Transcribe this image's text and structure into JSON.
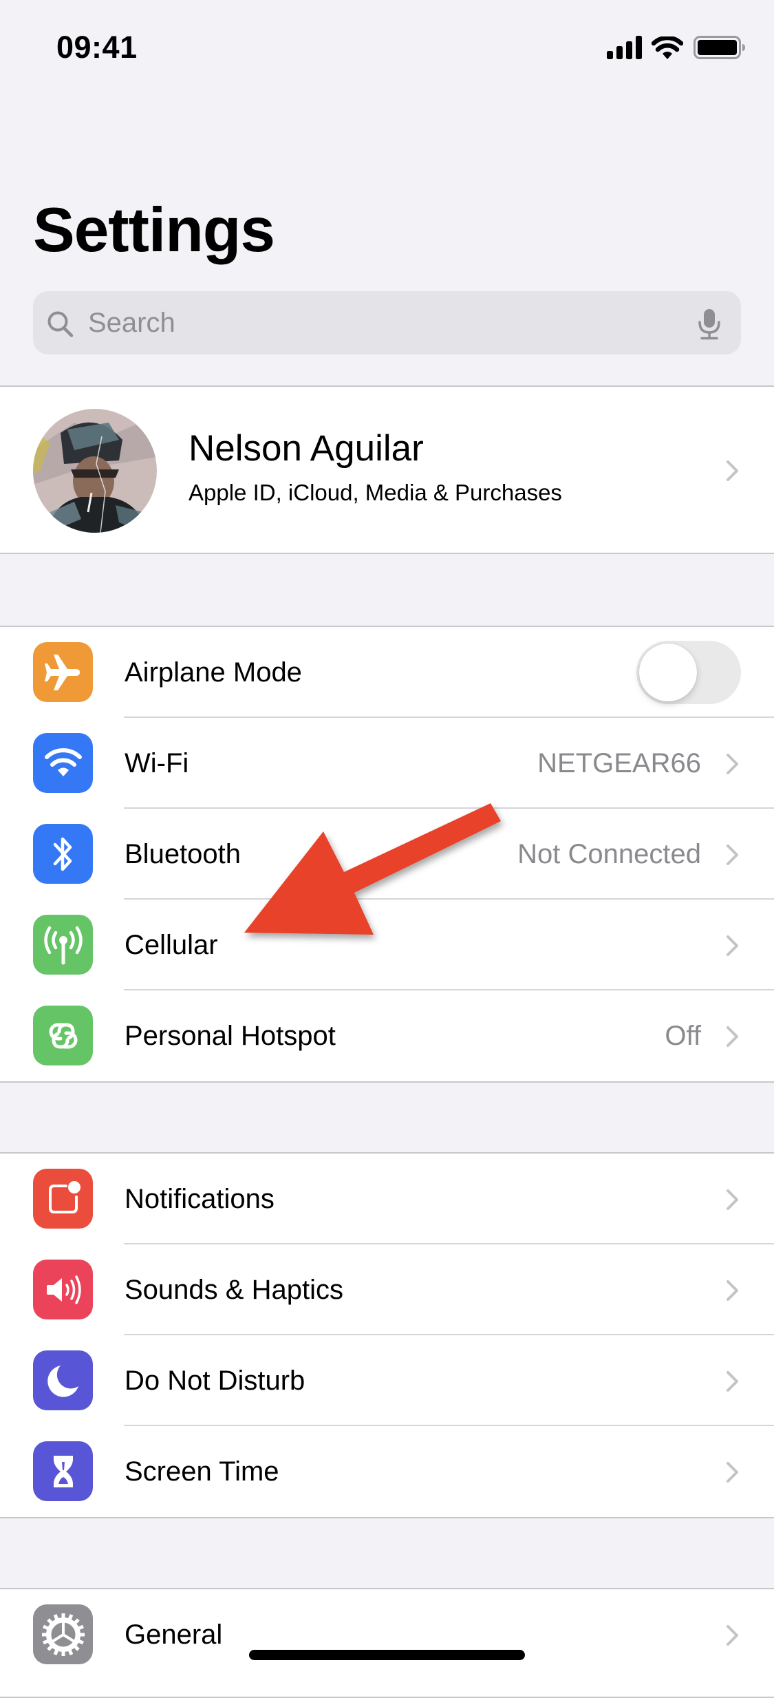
{
  "status_bar": {
    "time": "09:41",
    "icons": [
      "cellular-signal-icon",
      "wifi-icon",
      "battery-icon"
    ]
  },
  "header": {
    "title": "Settings"
  },
  "search": {
    "placeholder": "Search",
    "value": "",
    "icons": [
      "search-icon",
      "microphone-icon"
    ]
  },
  "profile": {
    "name": "Nelson Aguilar",
    "subtitle": "Apple ID, iCloud, Media & Purchases"
  },
  "groups": [
    {
      "rows": [
        {
          "label": "Airplane Mode",
          "icon": "airplane-icon",
          "icon_color": "#f09a37",
          "type": "toggle",
          "toggle_on": false
        },
        {
          "label": "Wi-Fi",
          "icon": "wifi-icon",
          "icon_color": "#3478f6",
          "value": "NETGEAR66",
          "type": "link"
        },
        {
          "label": "Bluetooth",
          "icon": "bluetooth-icon",
          "icon_color": "#3478f6",
          "value": "Not Connected",
          "type": "link"
        },
        {
          "label": "Cellular",
          "icon": "cellular-antenna-icon",
          "icon_color": "#65c466",
          "value": "",
          "type": "link"
        },
        {
          "label": "Personal Hotspot",
          "icon": "hotspot-icon",
          "icon_color": "#65c466",
          "value": "Off",
          "type": "link"
        }
      ]
    },
    {
      "rows": [
        {
          "label": "Notifications",
          "icon": "notifications-icon",
          "icon_color": "#eb4d3d",
          "type": "link"
        },
        {
          "label": "Sounds & Haptics",
          "icon": "speaker-icon",
          "icon_color": "#eb445a",
          "type": "link"
        },
        {
          "label": "Do Not Disturb",
          "icon": "moon-icon",
          "icon_color": "#5856d6",
          "type": "link"
        },
        {
          "label": "Screen Time",
          "icon": "hourglass-icon",
          "icon_color": "#5856d6",
          "type": "link"
        }
      ]
    },
    {
      "rows": [
        {
          "label": "General",
          "icon": "gear-icon",
          "icon_color": "#8e8e93",
          "type": "link"
        }
      ]
    }
  ],
  "annotation": {
    "type": "arrow",
    "color": "#e8432a",
    "points_to": "Cellular"
  },
  "colors": {
    "background": "#f2f2f7",
    "secondary_text": "#8a8a8e",
    "chevron": "#c4c4c7",
    "separator": "#c8c8cc"
  }
}
